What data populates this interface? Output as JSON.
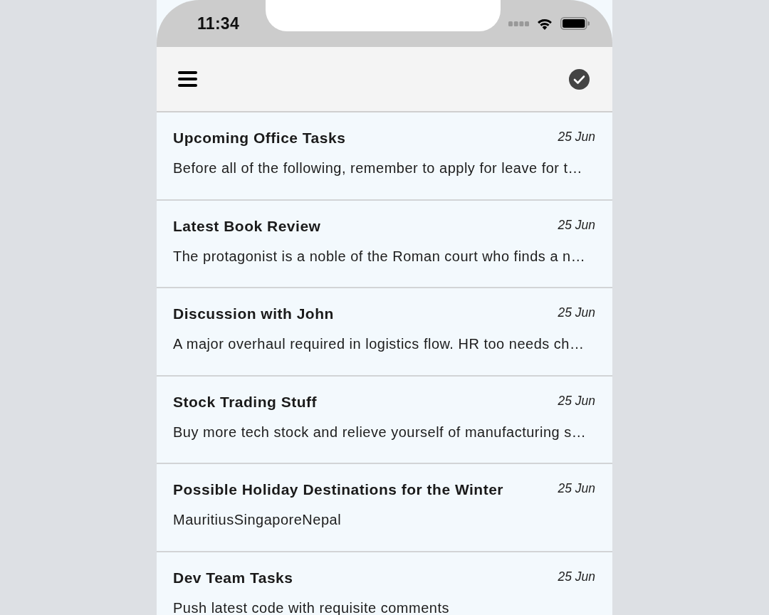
{
  "status_bar": {
    "time": "11:34"
  },
  "notes": [
    {
      "title": "Upcoming Office Tasks",
      "date": "25 Jun",
      "preview": "Before all of the following, remember to apply for leave for t…"
    },
    {
      "title": "Latest Book Review",
      "date": "25 Jun",
      "preview": "The protagonist is a noble of the Roman court who finds a n…"
    },
    {
      "title": "Discussion with John",
      "date": "25 Jun",
      "preview": "A major overhaul required in logistics flow. HR too needs ch…"
    },
    {
      "title": "Stock Trading Stuff",
      "date": "25 Jun",
      "preview": "Buy more tech stock and relieve yourself of manufacturing s…"
    },
    {
      "title": "Possible Holiday Destinations for the Winter",
      "date": "25 Jun",
      "preview": "MauritiusSingaporeNepal"
    },
    {
      "title": "Dev Team Tasks",
      "date": "25 Jun",
      "preview": "Push latest code with requisite comments"
    }
  ]
}
